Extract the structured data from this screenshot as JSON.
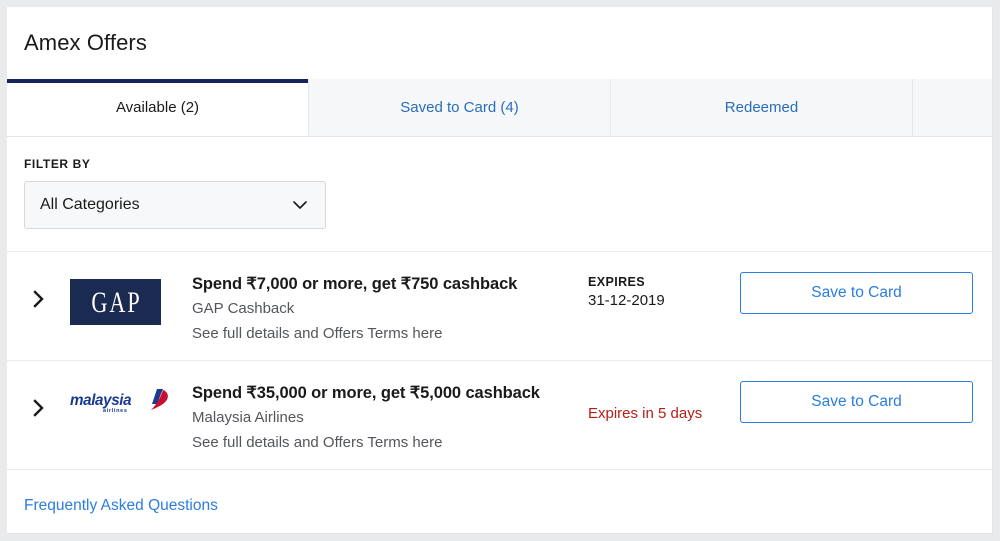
{
  "header": {
    "title": "Amex Offers"
  },
  "tabs": [
    {
      "label": "Available (2)",
      "active": true,
      "name": "tab-available"
    },
    {
      "label": "Saved to Card (4)",
      "active": false,
      "name": "tab-saved-to-card"
    },
    {
      "label": "Redeemed",
      "active": false,
      "name": "tab-redeemed"
    }
  ],
  "filter": {
    "label": "FILTER BY",
    "selected": "All Categories",
    "options": [
      "All Categories"
    ],
    "chevron_icon": "chevron-down-icon"
  },
  "offers": [
    {
      "expand_icon": "chevron-right-icon",
      "logo": "gap-logo",
      "logo_text": "GAP",
      "title": "Spend ₹7,000 or more, get ₹750 cashback",
      "merchant": "GAP Cashback",
      "terms": "See full details and Offers Terms here",
      "expires_label": "EXPIRES",
      "expires_value": "31-12-2019",
      "expires_soon": "",
      "action_label": "Save to Card"
    },
    {
      "expand_icon": "chevron-right-icon",
      "logo": "malaysia-airlines-logo",
      "logo_text": "malaysia",
      "logo_subtext": "airlines",
      "title": "Spend ₹35,000 or more, get ₹5,000 cashback",
      "merchant": "Malaysia Airlines",
      "terms": "See full details and Offers Terms here",
      "expires_label": "",
      "expires_value": "",
      "expires_soon": "Expires in 5 days",
      "action_label": "Save to Card"
    }
  ],
  "footer": {
    "faq_label": "Frequently Asked Questions"
  },
  "colors": {
    "page_background": "#e9eaec",
    "card_background": "#ffffff",
    "active_tab_indicator": "#17245c",
    "link_blue": "#2a7de1",
    "tab_blue": "#2a6ebb",
    "expiry_warning_red": "#b32017",
    "gap_navy": "#1b2a51",
    "malaysia_blue": "#1b3a8f",
    "malaysia_red": "#c8102e"
  }
}
